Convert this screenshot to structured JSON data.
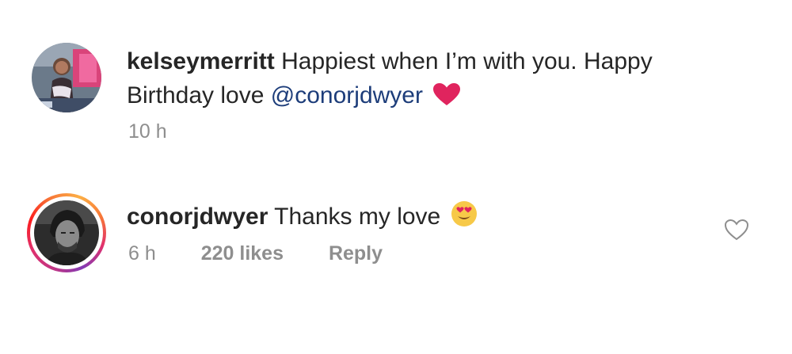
{
  "comments": [
    {
      "username": "kelseymerritt",
      "text": "Happiest when I’m with you. Happy Birthday love",
      "mention": "@conorjdwyer",
      "emoji": "heart-emoji",
      "time": "10 h"
    },
    {
      "username": "conorjdwyer",
      "text": "Thanks my love",
      "emoji": "smiling-face-with-heart-eyes-emoji",
      "time": "6 h",
      "likes": "220 likes",
      "reply_label": "Reply",
      "like_icon": "heart-outline-icon",
      "has_story_ring": true
    }
  ],
  "colors": {
    "text": "#262626",
    "muted": "#8e8e8e",
    "mention": "#1d3d7a",
    "heart": "#e0245e"
  }
}
